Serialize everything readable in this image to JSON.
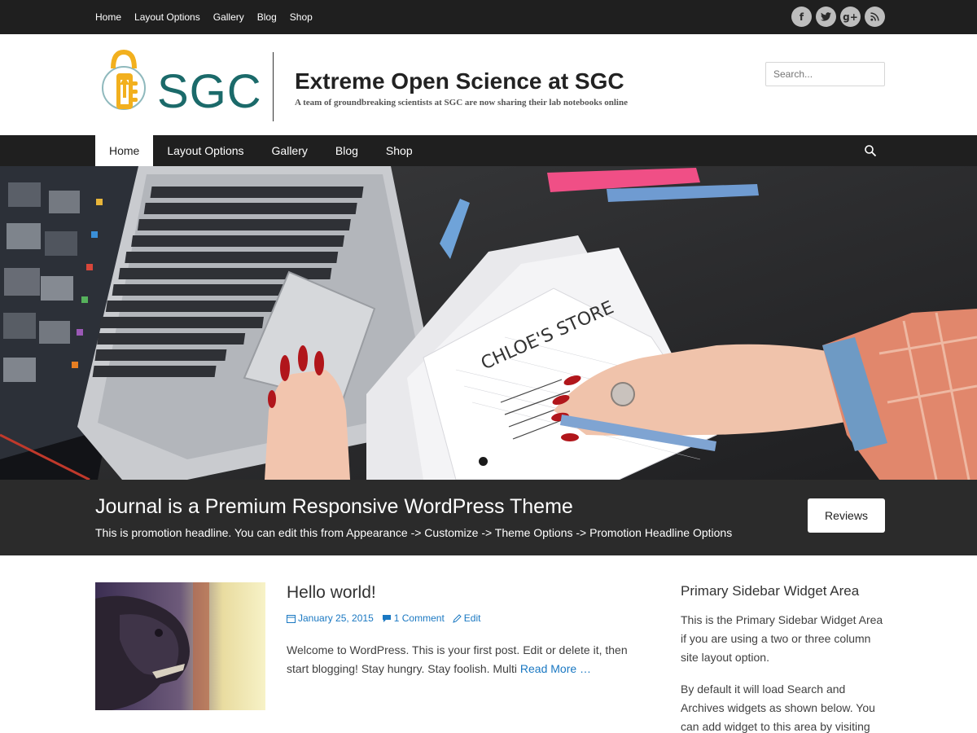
{
  "topbar": {
    "nav": [
      "Home",
      "Layout Options",
      "Gallery",
      "Blog",
      "Shop"
    ],
    "social": [
      {
        "icon": "facebook-icon",
        "glyph": "f"
      },
      {
        "icon": "twitter-icon",
        "glyph": "t"
      },
      {
        "icon": "google-plus-icon",
        "glyph": "g+"
      },
      {
        "icon": "rss-icon",
        "glyph": "◔"
      }
    ]
  },
  "header": {
    "logo_text": "SGC",
    "title": "Extreme Open Science at SGC",
    "tagline": "A team of groundbreaking scientists at SGC are now sharing their lab notebooks online",
    "search_placeholder": "Search..."
  },
  "mainnav": {
    "items": [
      "Home",
      "Layout Options",
      "Gallery",
      "Blog",
      "Shop"
    ],
    "active": "Home"
  },
  "hero": {
    "slide_count": 2,
    "active_slide": 1,
    "note_text": "CHLOE'S STORE"
  },
  "promo": {
    "title": "Journal is a Premium Responsive WordPress Theme",
    "subtitle": "This is promotion headline. You can edit this from Appearance -> Customize -> Theme Options -> Promotion Headline Options",
    "button": "Reviews"
  },
  "post": {
    "title": "Hello world!",
    "date": "January 25, 2015",
    "comments": "1 Comment",
    "edit": "Edit",
    "excerpt": "Welcome to WordPress. This is your first post. Edit or delete it, then start blogging! Stay hungry. Stay foolish. Multi",
    "read_more": "Read More …"
  },
  "sidebar": {
    "title": "Primary Sidebar Widget Area",
    "p1": "This is the Primary Sidebar Widget Area if you are using a two or three column site layout option.",
    "p2": "By default it will load Search and Archives widgets as shown below. You can add widget to this area by visiting your"
  },
  "colors": {
    "dark_bar": "#1f1f1f",
    "promo_bg": "#2b2b2b",
    "link": "#1a78c2",
    "logo_teal": "#1b6a6a",
    "logo_yellow": "#f2b01e"
  }
}
